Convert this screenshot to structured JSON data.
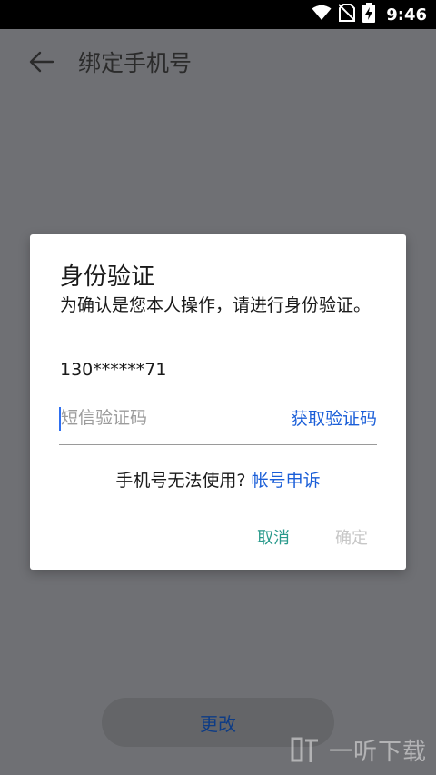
{
  "status_bar": {
    "time": "9:46",
    "icons": [
      "wifi-icon",
      "no-sim-icon",
      "battery-charging-icon"
    ]
  },
  "app_bar": {
    "back_icon": "arrow-left-icon",
    "title": "绑定手机号"
  },
  "dialog": {
    "title": "身份验证",
    "message": "为确认是您本人操作，请进行身份验证。",
    "phone": "130******71",
    "code_placeholder": "短信验证码",
    "code_value": "",
    "get_code_label": "获取验证码",
    "help_text": "手机号无法使用?",
    "appeal_link": "帐号申诉",
    "cancel_label": "取消",
    "confirm_label": "确定"
  },
  "page": {
    "change_button_label": "更改"
  },
  "watermark": {
    "text": "一听下载"
  },
  "colors": {
    "scrim": "#6f7074",
    "link": "#1a5ed8",
    "cancel": "#2a9a8c",
    "disabled": "#c7c7c7"
  }
}
